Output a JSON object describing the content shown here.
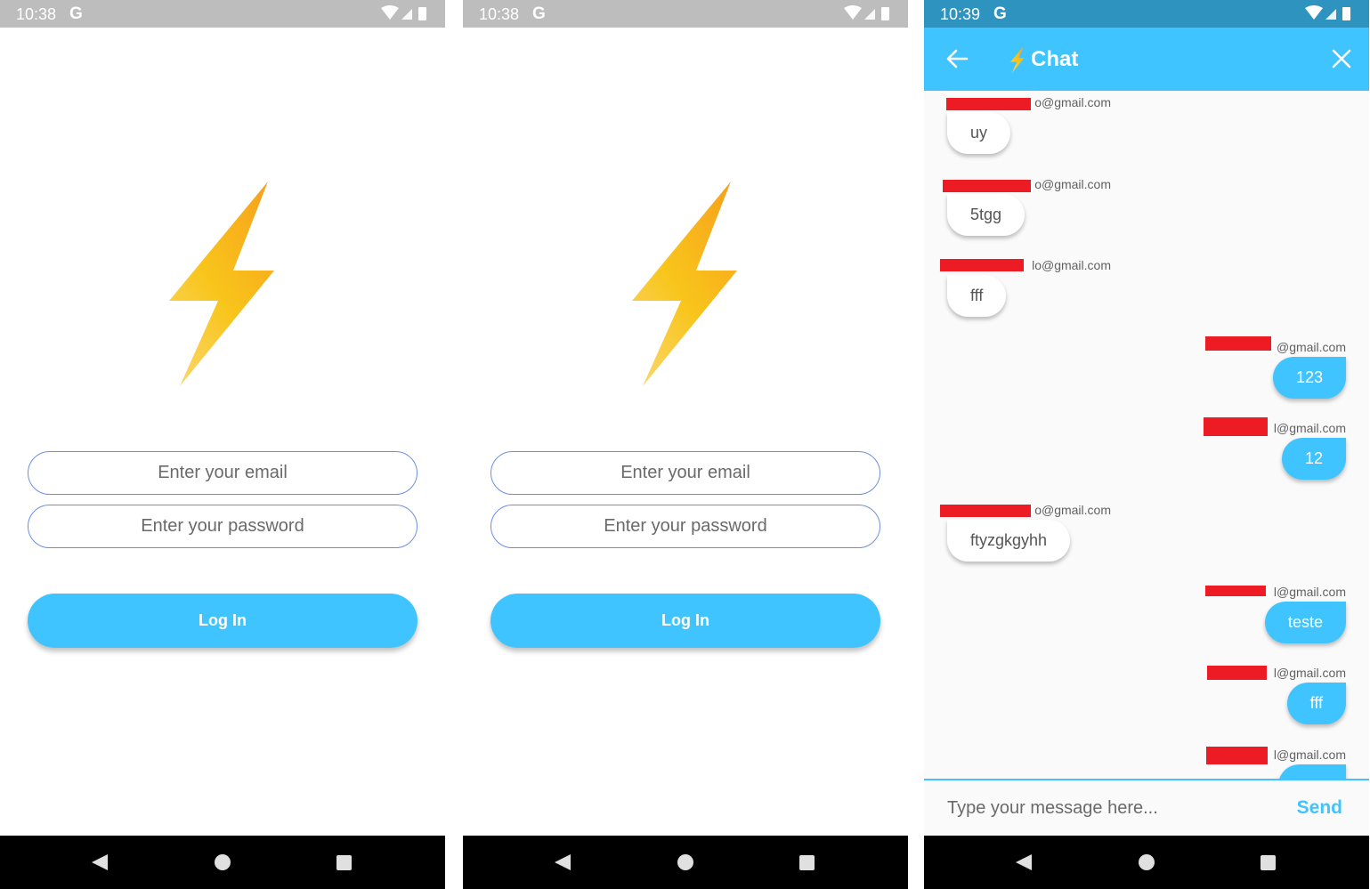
{
  "colors": {
    "accent": "#40c4ff",
    "status_bar_login": "#bdbdbd",
    "status_bar_chat": "#2f93c0",
    "field_border": "#6d8ee0",
    "bolt_gradient": [
      "#f7a21c",
      "#f8c51b",
      "#fbd66d"
    ],
    "redaction": "#ed1c24"
  },
  "login_screens": [
    {
      "status": {
        "time": "10:38",
        "g": "G"
      },
      "email_placeholder": "Enter your email",
      "password_placeholder": "Enter your password",
      "login_label": "Log In"
    },
    {
      "status": {
        "time": "10:38",
        "g": "G"
      },
      "email_placeholder": "Enter your email",
      "password_placeholder": "Enter your password",
      "login_label": "Log In"
    }
  ],
  "chat_screen": {
    "status": {
      "time": "10:39",
      "g": "G"
    },
    "title": "Chat",
    "composer_placeholder": "Type your message here...",
    "send_label": "Send",
    "messages": [
      {
        "side": "left",
        "sender": "o@gmail.com",
        "text": "uy"
      },
      {
        "side": "left",
        "sender": "o@gmail.com",
        "text": "5tgg"
      },
      {
        "side": "left",
        "sender": "lo@gmail.com",
        "text": "fff"
      },
      {
        "side": "right",
        "sender": "@gmail.com",
        "text": "123"
      },
      {
        "side": "right",
        "sender": "l@gmail.com",
        "text": "12"
      },
      {
        "side": "left",
        "sender": "o@gmail.com",
        "text": "ftyzgkgyhh"
      },
      {
        "side": "right",
        "sender": "l@gmail.com",
        "text": "teste"
      },
      {
        "side": "right",
        "sender": "l@gmail.com",
        "text": "fff"
      },
      {
        "side": "right",
        "sender": "l@gmail.com",
        "text": ""
      }
    ]
  },
  "icons": {
    "bolt": "lightning-bolt-icon",
    "back": "arrow-left-icon",
    "close": "close-icon",
    "nav_back": "triangle-back-icon",
    "nav_home": "circle-home-icon",
    "nav_recent": "square-recents-icon",
    "wifi": "wifi-icon",
    "signal": "signal-icon",
    "battery": "battery-icon"
  }
}
